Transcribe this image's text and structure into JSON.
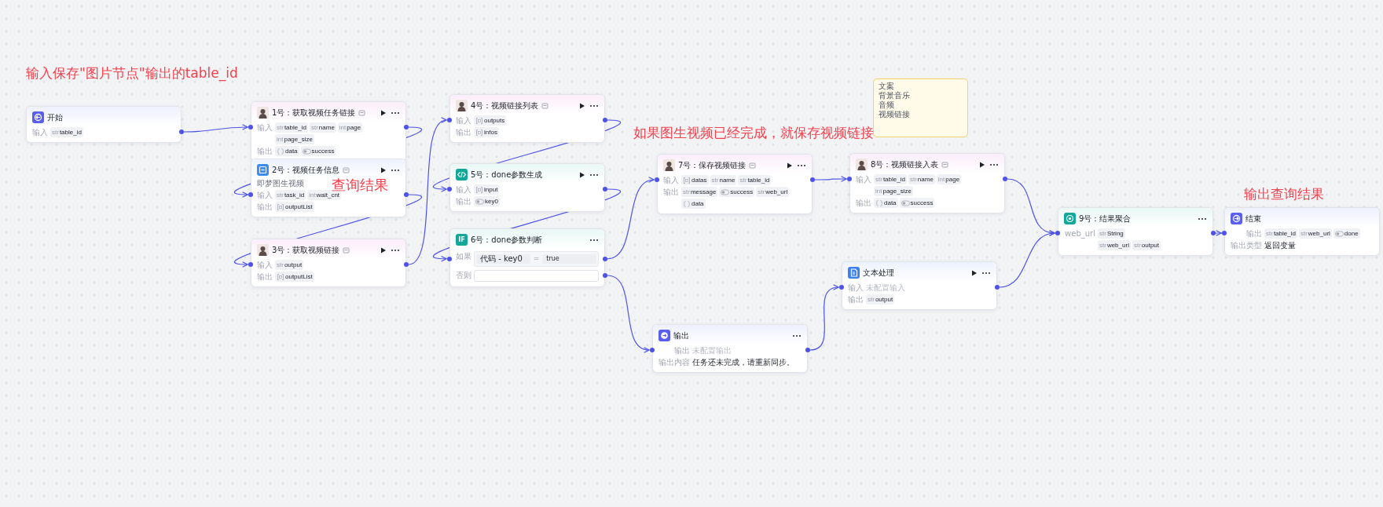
{
  "annotations": [
    {
      "text": "输入保存\"图片节点\"输出的table_id"
    },
    {
      "text": "查询结果"
    },
    {
      "text": "如果图生视频已经完成，就保存视频链接"
    },
    {
      "text": "输出查询结果"
    }
  ],
  "note": {
    "lines": [
      "文案",
      "背景音乐",
      "音频",
      "视频链接"
    ]
  },
  "nodes": [
    {
      "kind": "start",
      "title": "开始",
      "badge_icon": false,
      "run_button": false,
      "menu_button": false,
      "rows": [
        {
          "label": "输入",
          "params": [
            {
              "tag": "str",
              "name": "table_id"
            }
          ]
        }
      ]
    },
    {
      "kind": "plugin",
      "title": "1号：获取视频任务链接",
      "badge_icon": true,
      "run_button": true,
      "menu_button": true,
      "rows": [
        {
          "label": "输入",
          "params": [
            {
              "tag": "str",
              "name": "table_id"
            },
            {
              "tag": "str",
              "name": "name"
            },
            {
              "tag": "int",
              "name": "page"
            },
            {
              "tag": "int",
              "name": "page_size"
            }
          ]
        },
        {
          "label": "输出",
          "params": [
            {
              "kind": "object",
              "name": "data"
            },
            {
              "kind": "boolean",
              "name": "success"
            }
          ]
        }
      ]
    },
    {
      "kind": "app",
      "title": "2号：视频任务信息",
      "subtitle": "即梦图生视频",
      "badge_icon": true,
      "run_button": true,
      "menu_button": true,
      "rows": [
        {
          "label": "输入",
          "params": [
            {
              "tag": "str",
              "name": "task_id"
            },
            {
              "tag": "int",
              "name": "wait_cnt"
            }
          ]
        },
        {
          "label": "输出",
          "params": [
            {
              "kind": "array",
              "name": "outputList"
            }
          ]
        }
      ]
    },
    {
      "kind": "plugin",
      "title": "3号：获取视频链接",
      "badge_icon": true,
      "run_button": true,
      "menu_button": true,
      "rows": [
        {
          "label": "输入",
          "params": [
            {
              "tag": "str",
              "name": "output"
            }
          ]
        },
        {
          "label": "输出",
          "params": [
            {
              "kind": "array",
              "name": "outputList"
            }
          ]
        }
      ]
    },
    {
      "kind": "plugin",
      "title": "4号：视频链接列表",
      "badge_icon": true,
      "run_button": true,
      "menu_button": true,
      "rows": [
        {
          "label": "输入",
          "params": [
            {
              "kind": "array",
              "name": "outputs"
            }
          ]
        },
        {
          "label": "输出",
          "params": [
            {
              "kind": "array",
              "name": "infos"
            }
          ]
        }
      ]
    },
    {
      "kind": "code",
      "title": "5号：done参数生成",
      "badge_icon": false,
      "run_button": true,
      "menu_button": true,
      "rows": [
        {
          "label": "输入",
          "params": [
            {
              "kind": "array",
              "name": "input"
            }
          ]
        },
        {
          "label": "输出",
          "params": [
            {
              "kind": "boolean",
              "name": "key0"
            }
          ]
        }
      ]
    },
    {
      "kind": "condition",
      "title": "6号：done参数判断",
      "icon_label": "IF",
      "badge_icon": false,
      "run_button": false,
      "menu_button": true,
      "condition": {
        "if_label": "如果",
        "left": "代码 - key0",
        "operator": "=",
        "right": "true",
        "else_label": "否则"
      }
    },
    {
      "kind": "plugin",
      "title": "7号：保存视频链接",
      "badge_icon": true,
      "run_button": true,
      "menu_button": true,
      "rows": [
        {
          "label": "输入",
          "params": [
            {
              "kind": "array",
              "name": "datas"
            },
            {
              "tag": "str",
              "name": "name"
            },
            {
              "tag": "str",
              "name": "table_id"
            }
          ]
        },
        {
          "label": "输出",
          "params": [
            {
              "tag": "str",
              "name": "message"
            },
            {
              "kind": "boolean",
              "name": "success"
            },
            {
              "tag": "str",
              "name": "web_url"
            },
            {
              "kind": "object",
              "name": "data"
            }
          ]
        }
      ]
    },
    {
      "kind": "plugin",
      "title": "8号：视频链接入表",
      "badge_icon": true,
      "run_button": true,
      "menu_button": true,
      "rows": [
        {
          "label": "输入",
          "params": [
            {
              "tag": "str",
              "name": "table_id"
            },
            {
              "tag": "str",
              "name": "name"
            },
            {
              "tag": "int",
              "name": "page"
            },
            {
              "tag": "int",
              "name": "page_size"
            }
          ]
        },
        {
          "label": "输出",
          "params": [
            {
              "kind": "object",
              "name": "data"
            },
            {
              "kind": "boolean",
              "name": "success"
            }
          ]
        }
      ]
    },
    {
      "kind": "output",
      "title": "输出",
      "badge_icon": false,
      "run_button": false,
      "menu_button": true,
      "rows": [
        {
          "label": "输出",
          "value": "未配置输出",
          "muted": true
        },
        {
          "label": "输出内容",
          "value": "任务还未完成，请重新同步。",
          "muted": false
        }
      ]
    },
    {
      "kind": "text",
      "title": "文本处理",
      "badge_icon": false,
      "run_button": true,
      "menu_button": true,
      "rows": [
        {
          "label": "输入",
          "value": "未配置输入",
          "muted": true
        },
        {
          "label": "输出",
          "params": [
            {
              "tag": "str",
              "name": "output"
            }
          ]
        }
      ]
    },
    {
      "kind": "aggregate",
      "title": "9号：结果聚合",
      "badge_icon": false,
      "run_button": false,
      "menu_button": true,
      "rows": [
        {
          "label": "web_url",
          "params": [
            {
              "tag": "str",
              "name": "String"
            }
          ]
        },
        {
          "params": [
            {
              "tag": "str",
              "name": "web_url"
            },
            {
              "tag": "str",
              "name": "output"
            }
          ]
        }
      ]
    },
    {
      "kind": "end",
      "title": "结束",
      "badge_icon": false,
      "run_button": false,
      "menu_button": false,
      "rows": [
        {
          "label": "输出",
          "params": [
            {
              "tag": "str",
              "name": "table_id"
            },
            {
              "tag": "str",
              "name": "web_url"
            },
            {
              "kind": "boolean",
              "name": "done"
            }
          ]
        },
        {
          "label": "输出类型",
          "value": "返回变量",
          "muted": false
        }
      ]
    }
  ]
}
